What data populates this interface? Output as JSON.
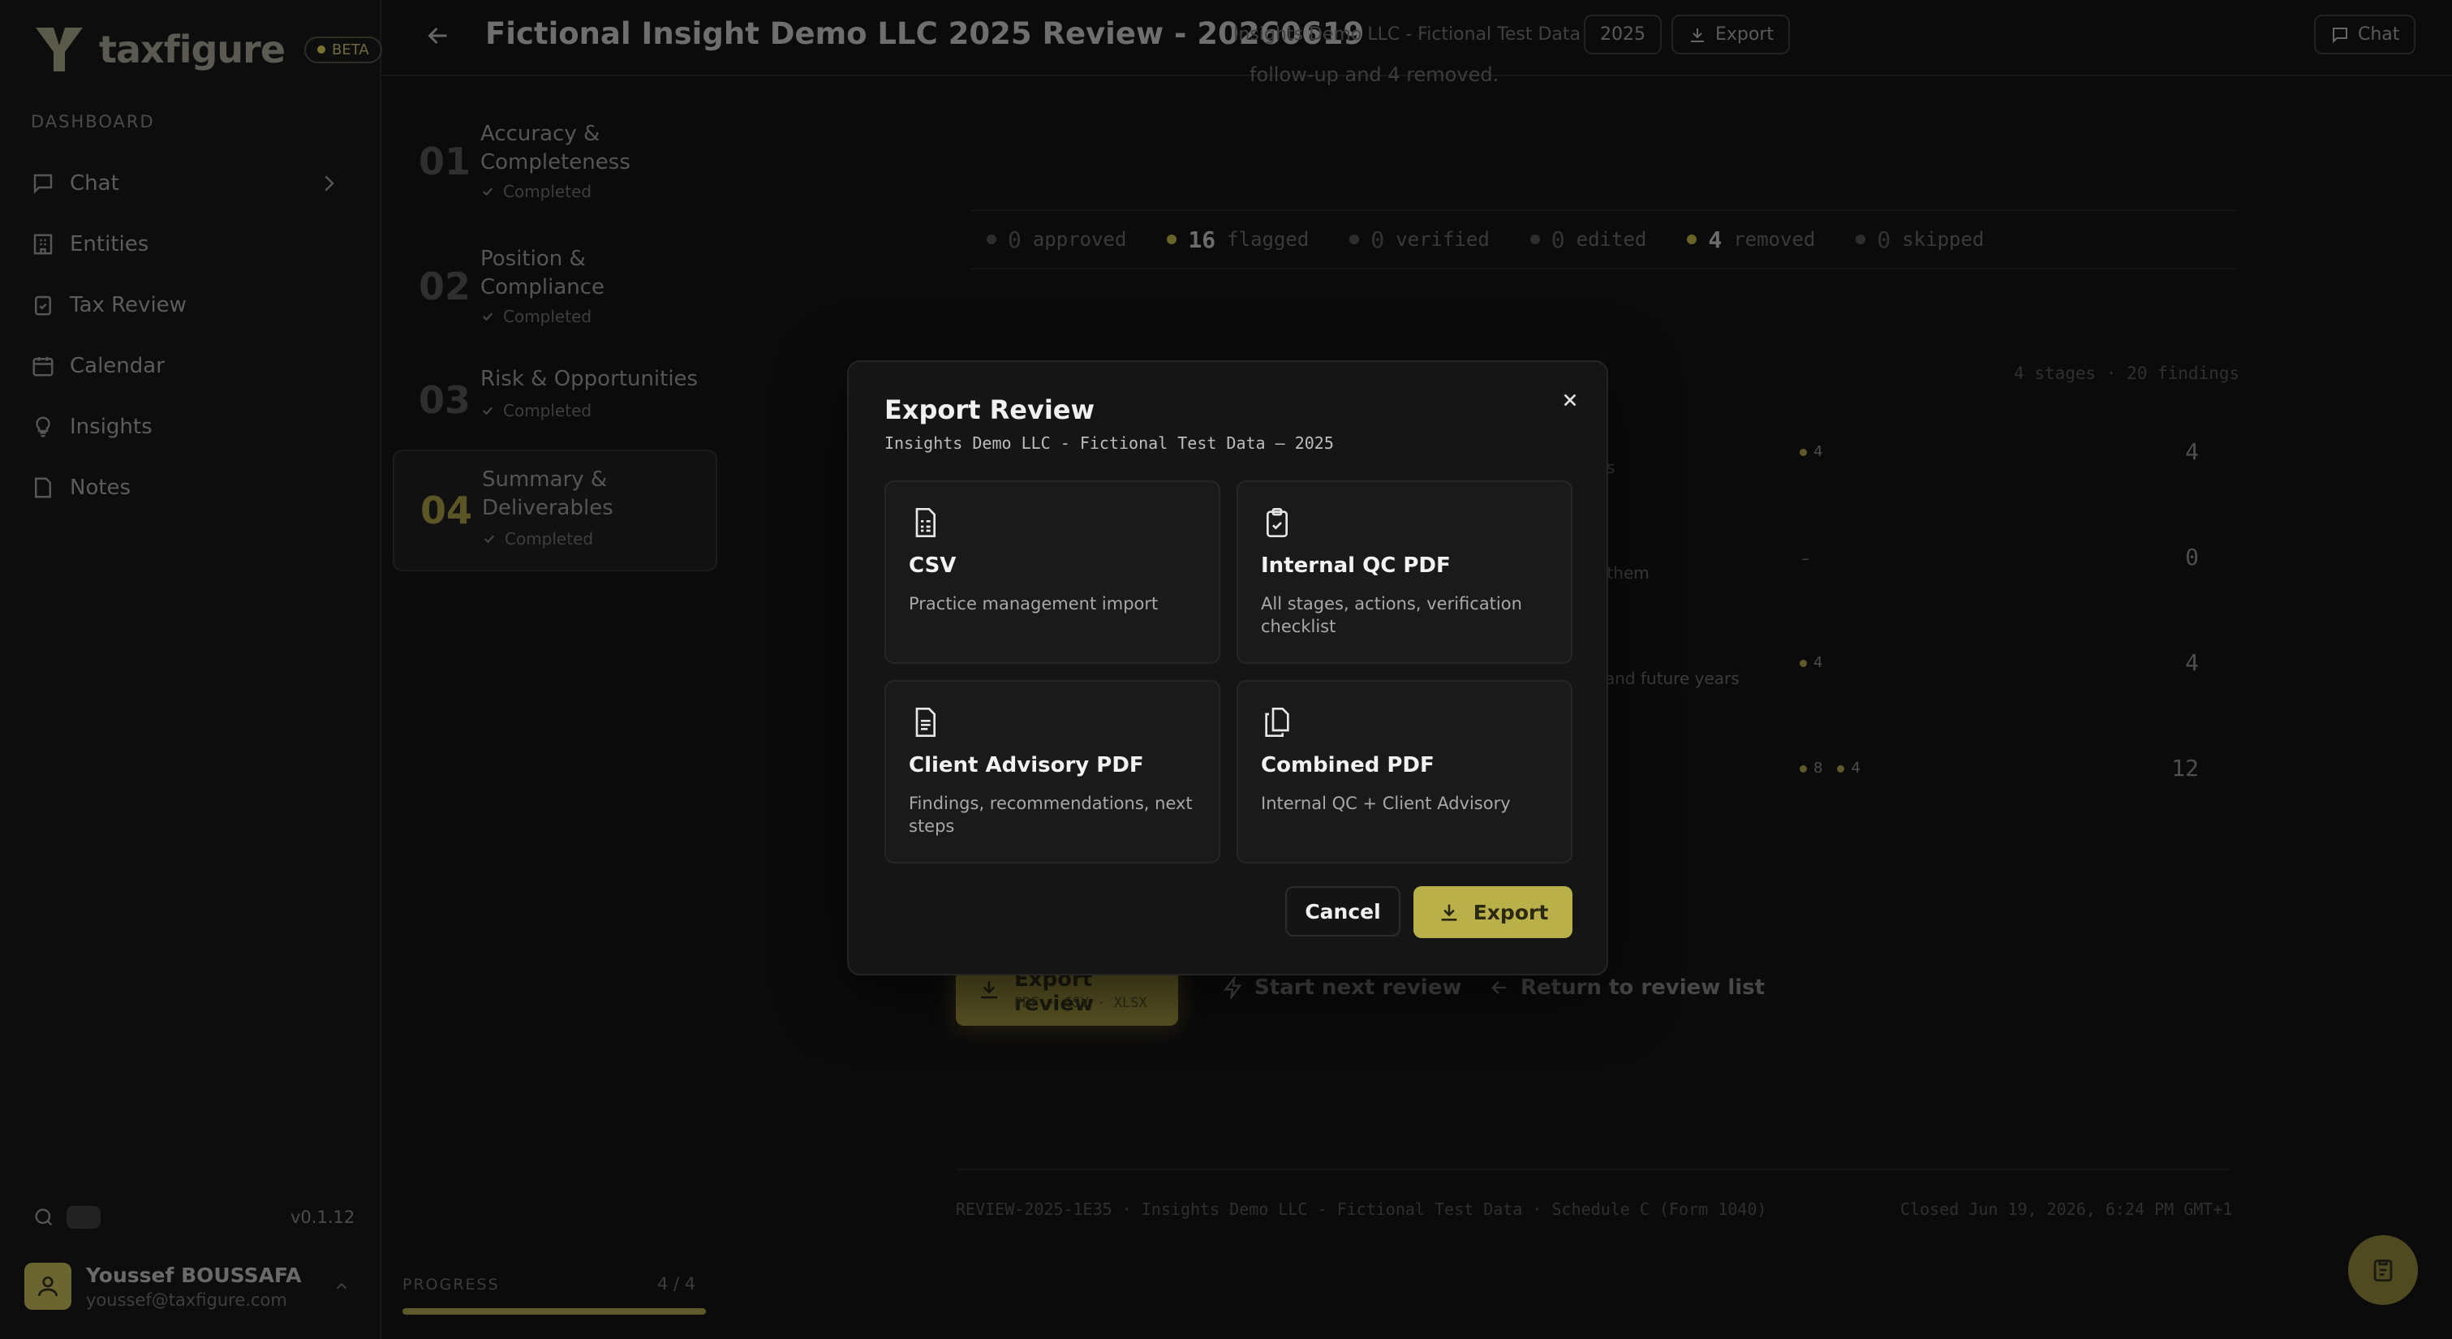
{
  "app": {
    "brand": "taxfigure",
    "beta_label": "BETA",
    "section_label": "DASHBOARD",
    "nav": [
      {
        "label": "Chat"
      },
      {
        "label": "Entities"
      },
      {
        "label": "Tax Review"
      },
      {
        "label": "Calendar"
      },
      {
        "label": "Insights"
      },
      {
        "label": "Notes"
      }
    ],
    "version": "v0.1.12",
    "user": {
      "name": "Youssef BOUSSAFA",
      "email": "youssef@taxfigure.com"
    }
  },
  "header": {
    "title": "Fictional Insight Demo LLC 2025 Review - 20260619",
    "subtitle": "Insights Demo LLC - Fictional Test Data",
    "year": "2025",
    "export_label": "Export",
    "chat_label": "Chat"
  },
  "stages": [
    {
      "num": "01",
      "name": "Accuracy & Completeness",
      "status": "Completed"
    },
    {
      "num": "02",
      "name": "Position & Compliance",
      "status": "Completed"
    },
    {
      "num": "03",
      "name": "Risk & Opportunities",
      "status": "Completed"
    },
    {
      "num": "04",
      "name": "Summary & Deliverables",
      "status": "Completed"
    }
  ],
  "progress": {
    "label": "PROGRESS",
    "count": "4 / 4",
    "fraction": 1.0
  },
  "background": {
    "header_fragment": "follow-up and 4 removed.",
    "summary": [
      {
        "count": "0",
        "label": "approved"
      },
      {
        "count": "16",
        "label": "flagged"
      },
      {
        "count": "0",
        "label": "verified"
      },
      {
        "count": "0",
        "label": "edited"
      },
      {
        "count": "4",
        "label": "removed"
      },
      {
        "count": "0",
        "label": "skipped"
      }
    ],
    "stages_meta": "4 stages · 20 findings",
    "rows": [
      {
        "fragment": "s",
        "dots": [
          "4"
        ],
        "count": "4"
      },
      {
        "fragment": "rt them",
        "dots": [
          "–"
        ],
        "count": "0"
      },
      {
        "fragment": "and future years",
        "dots": [
          "4"
        ],
        "count": "4"
      },
      {
        "fragment": "",
        "dots": [
          "8",
          "4"
        ],
        "count": "12"
      }
    ],
    "export_review_label": "Export review",
    "export_review_formats": "PDF · CSV · XLSX",
    "next_review_label": "Start next review",
    "return_label": "Return to review list",
    "footer_left": "REVIEW-2025-1E35 · Insights Demo LLC - Fictional Test Data · Schedule C (Form 1040)",
    "footer_right": "Closed Jun 19, 2026, 6:24 PM GMT+1"
  },
  "modal": {
    "title": "Export Review",
    "subtitle": "Insights Demo LLC - Fictional Test Data — 2025",
    "options": [
      {
        "icon": "spreadsheet-file-icon",
        "title": "CSV",
        "desc": "Practice management import"
      },
      {
        "icon": "clipboard-check-icon",
        "title": "Internal QC PDF",
        "desc": "All stages, actions, verification checklist"
      },
      {
        "icon": "document-file-icon",
        "title": "Client Advisory PDF",
        "desc": "Findings, recommendations, next steps"
      },
      {
        "icon": "files-copy-icon",
        "title": "Combined PDF",
        "desc": "Internal QC + Client Advisory"
      }
    ],
    "cancel_label": "Cancel",
    "export_label": "Export"
  },
  "colors": {
    "accent": "#b9b04a",
    "modal_bg": "#151516",
    "page_bg": "#0b0b0c"
  }
}
